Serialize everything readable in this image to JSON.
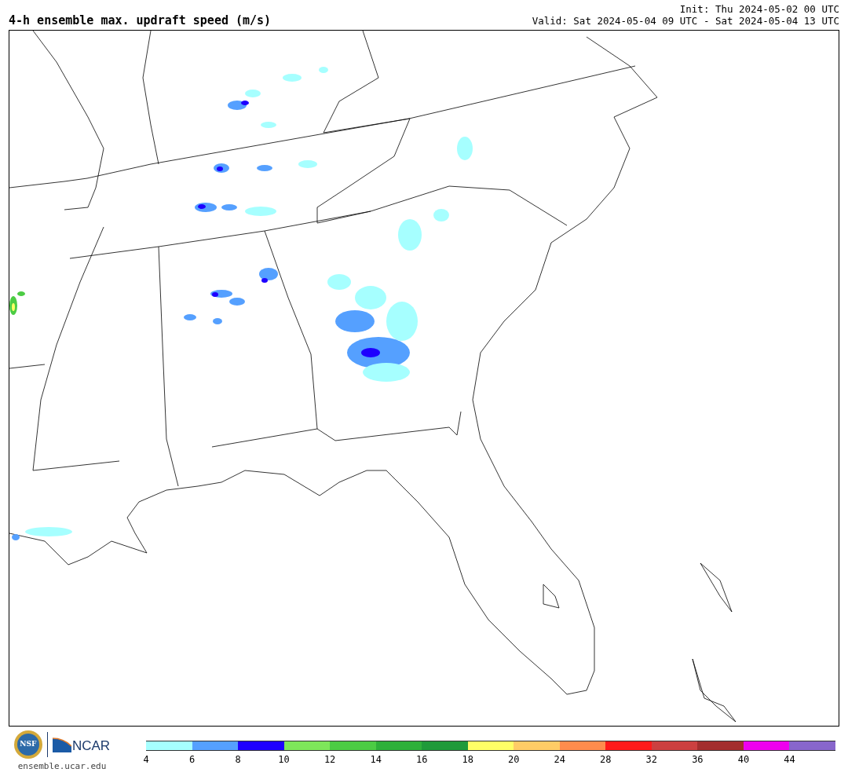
{
  "header": {
    "title": "4-h ensemble max. updraft speed (m/s)",
    "init": "Init: Thu 2024-05-02 00 UTC",
    "valid": "Valid: Sat 2024-05-04 09 UTC - Sat 2024-05-04 13 UTC"
  },
  "footer": {
    "nsf": "NSF",
    "ncar": "NCAR",
    "url": "ensemble.ucar.edu"
  },
  "legend": [
    {
      "label": "4",
      "color": "#a6ffff"
    },
    {
      "label": "6",
      "color": "#55a0ff"
    },
    {
      "label": "8",
      "color": "#1e00ff"
    },
    {
      "label": "10",
      "color": "#7ee65a"
    },
    {
      "label": "12",
      "color": "#4ccc44"
    },
    {
      "label": "14",
      "color": "#2eb03a"
    },
    {
      "label": "16",
      "color": "#1f9a3a"
    },
    {
      "label": "18",
      "color": "#ffff66"
    },
    {
      "label": "20",
      "color": "#ffcc66"
    },
    {
      "label": "24",
      "color": "#ff8c4d"
    },
    {
      "label": "28",
      "color": "#ff1a1a"
    },
    {
      "label": "32",
      "color": "#cc4040"
    },
    {
      "label": "36",
      "color": "#a32e2e"
    },
    {
      "label": "40",
      "color": "#ee00ee"
    },
    {
      "label": "44",
      "color": "#8866cc"
    }
  ]
}
